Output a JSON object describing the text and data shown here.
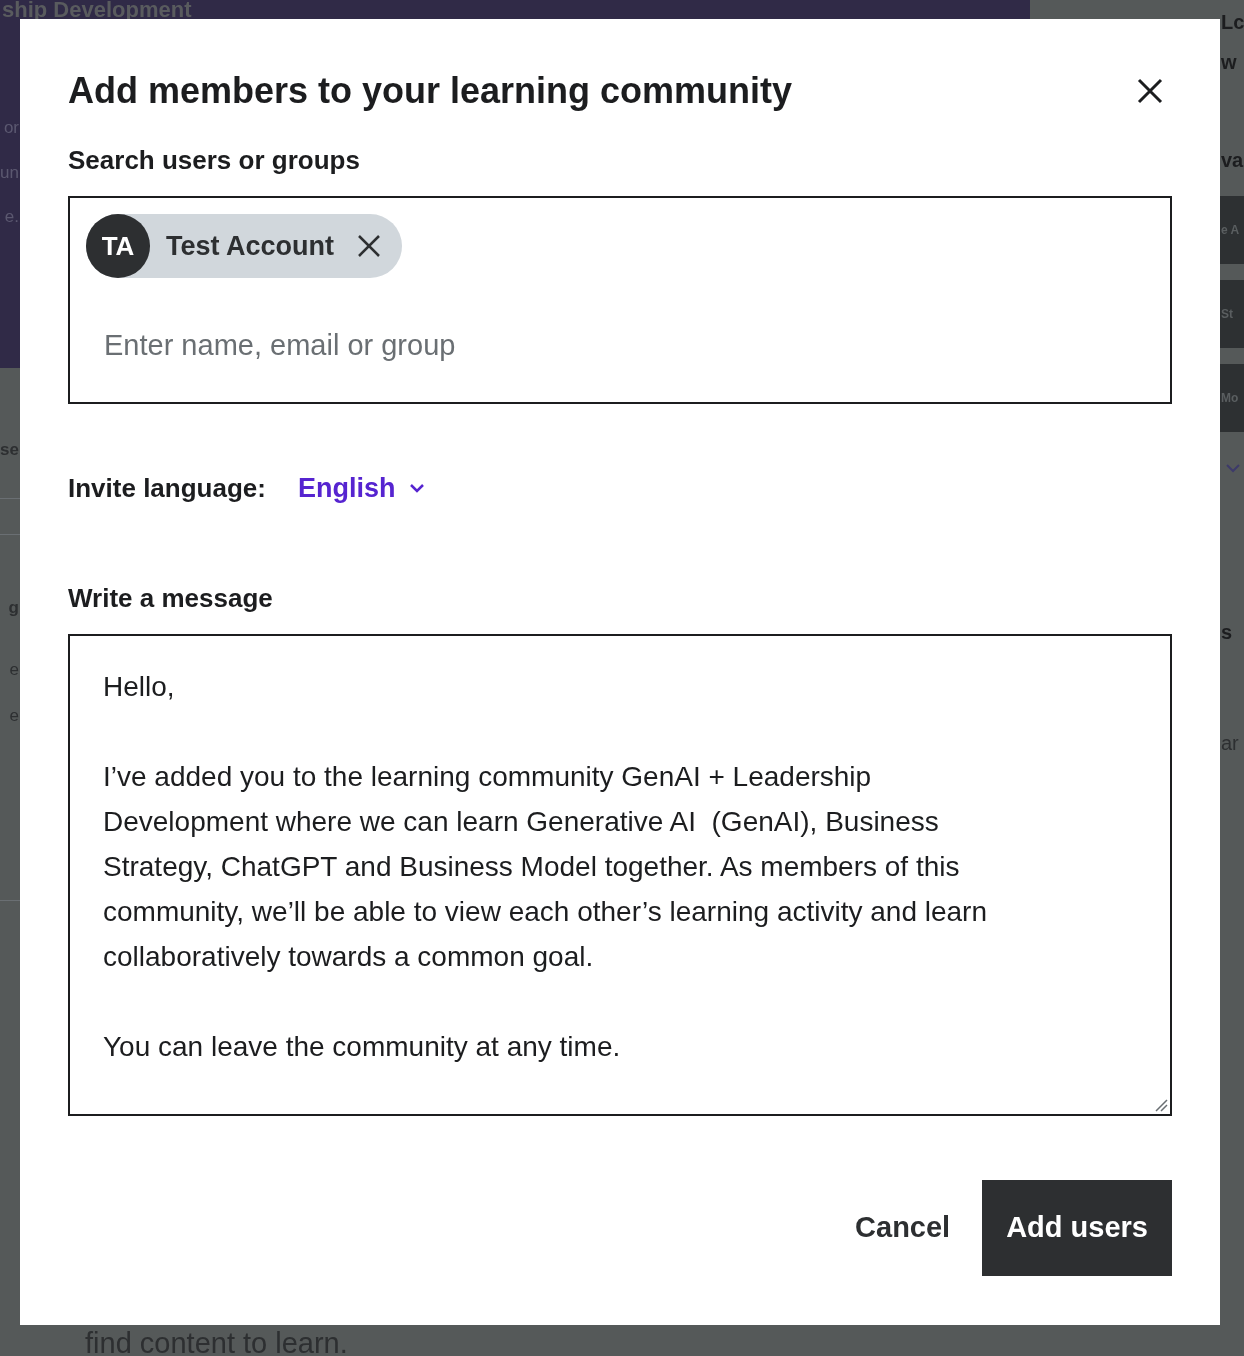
{
  "background": {
    "heading": "ship Development",
    "footer_text": "find content to learn.",
    "left_fragments": [
      {
        "text": "or",
        "kind": "plain"
      },
      {
        "text": "un",
        "kind": "plain"
      },
      {
        "text": "e.",
        "kind": "plain"
      },
      {
        "text": "se",
        "kind": "bold"
      },
      {
        "text": "g",
        "kind": "bold"
      },
      {
        "text": "e",
        "kind": "plain"
      },
      {
        "text": "e",
        "kind": "plain"
      }
    ],
    "right_fragments": [
      {
        "text": "Lc",
        "kind": "bold"
      },
      {
        "text": "w",
        "kind": "bold"
      },
      {
        "text": "va",
        "kind": "bold"
      },
      {
        "text": "e A",
        "kind": "button"
      },
      {
        "text": "St",
        "kind": "button"
      },
      {
        "text": "Mo",
        "kind": "button"
      },
      {
        "text": "s",
        "kind": "bold"
      },
      {
        "text": "ar",
        "kind": "plain"
      }
    ]
  },
  "dialog": {
    "title": "Add members to your learning community",
    "search": {
      "label": "Search users or groups",
      "chips": [
        {
          "initials": "TA",
          "name": "Test Account"
        }
      ],
      "placeholder": "Enter name, email or group"
    },
    "invite_language": {
      "label": "Invite language:",
      "value": "English"
    },
    "message": {
      "label": "Write a message",
      "value": "Hello,\n\nI’ve added you to the learning community GenAI + Leadership Development where we can learn Generative AI  (GenAI), Business Strategy, ChatGPT and Business Model together. As members of this community, we’ll be able to view each other’s learning activity and learn collaboratively towards a common goal.\n\nYou can leave the community at any time."
    },
    "buttons": [
      {
        "label": "Cancel",
        "kind": "secondary"
      },
      {
        "label": "Add users",
        "kind": "primary"
      }
    ]
  }
}
